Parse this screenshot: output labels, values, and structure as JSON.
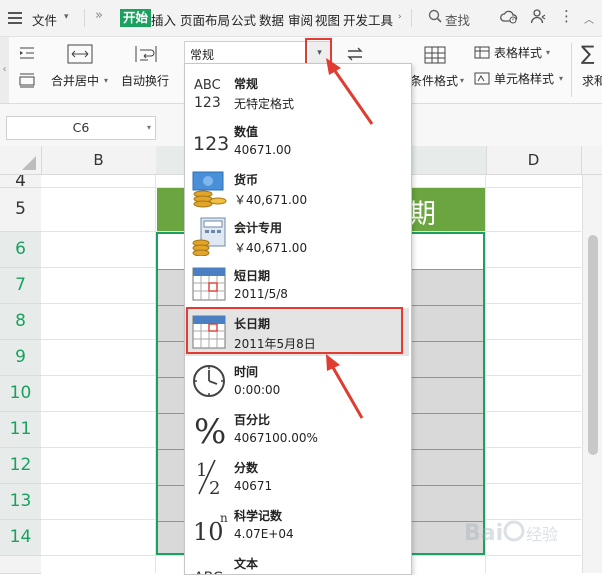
{
  "topbar": {
    "file_label": "文件",
    "tabs": [
      "开始",
      "插入",
      "页面布局",
      "公式",
      "数据",
      "审阅",
      "视图",
      "开发工具"
    ],
    "search_label": "查找"
  },
  "ribbon": {
    "merge_label": "合并居中",
    "wrap_label": "自动换行",
    "format_value": "常规",
    "cond_format_label": "条件格式",
    "table_style_label": "表格样式",
    "cell_style_label": "单元格样式",
    "sum_label": "求和"
  },
  "formula_bar": {
    "name_box": "C6"
  },
  "grid": {
    "columns": [
      "B",
      "D"
    ],
    "rows": [
      "4",
      "5",
      "6",
      "7",
      "8",
      "9",
      "10",
      "11",
      "12",
      "13",
      "14"
    ],
    "title_cell_text": "期"
  },
  "dropdown": {
    "items": [
      {
        "name": "常规",
        "example": "无特定格式",
        "icon": "abc-123-icon"
      },
      {
        "name": "数值",
        "example": "40671.00",
        "icon": "number-123-icon"
      },
      {
        "name": "货币",
        "example": "￥40,671.00",
        "icon": "currency-coins-icon"
      },
      {
        "name": "会计专用",
        "example": "￥40,671.00",
        "icon": "accounting-calculator-icon"
      },
      {
        "name": "短日期",
        "example": "2011/5/8",
        "icon": "calendar-icon"
      },
      {
        "name": "长日期",
        "example": "2011年5月8日",
        "icon": "calendar-icon"
      },
      {
        "name": "时间",
        "example": "0:00:00",
        "icon": "clock-icon"
      },
      {
        "name": "百分比",
        "example": "4067100.00%",
        "icon": "percent-icon"
      },
      {
        "name": "分数",
        "example": "40671",
        "icon": "fraction-icon"
      },
      {
        "name": "科学记数",
        "example": "4.07E+04",
        "icon": "scientific-10n-icon"
      },
      {
        "name": "文本",
        "example": "",
        "icon": "text-abc-icon"
      }
    ],
    "highlighted_index": 5
  },
  "colors": {
    "accent_green": "#1aa160",
    "title_fill": "#6aa53f",
    "cell_fill": "#d9d9d9",
    "annotation_red": "#e03c31"
  }
}
